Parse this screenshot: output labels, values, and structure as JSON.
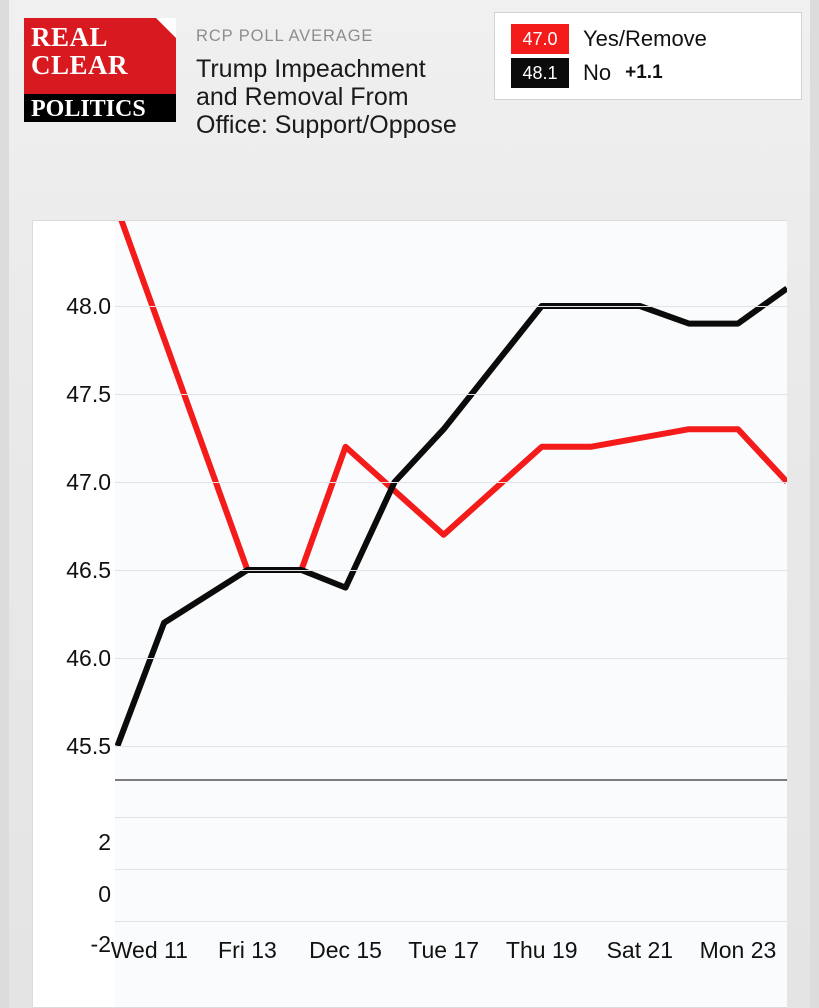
{
  "brand": {
    "line1": "REAL",
    "line2": "CLEAR",
    "line3": "POLITICS"
  },
  "header": {
    "kicker": "RCP POLL AVERAGE",
    "title": "Trump Impeachment and Removal From Office: Support/Oppose"
  },
  "legend": {
    "items": [
      {
        "value": "47.0",
        "label": "Yes/Remove",
        "delta": "",
        "color": "#f41b1b"
      },
      {
        "value": "48.1",
        "label": "No",
        "delta": "+1.1",
        "color": "#0b0b0b"
      }
    ]
  },
  "chart_data": {
    "type": "line",
    "title": "Trump Impeachment and Removal From Office: Support/Oppose",
    "subtitle": "RCP POLL AVERAGE",
    "xlabel": "",
    "ylabel": "",
    "grid": true,
    "legend_position": "top-right",
    "x_tick_labels": [
      "Wed 11",
      "Fri 13",
      "Dec 15",
      "Tue 17",
      "Thu 19",
      "Sat 21",
      "Mon 23"
    ],
    "x_tick_positions": [
      11,
      13,
      15,
      17,
      19,
      21,
      23
    ],
    "y_tick_labels": [
      "48.0",
      "47.5",
      "47.0",
      "46.5",
      "46.0",
      "45.5",
      "2",
      "0",
      "-2"
    ],
    "y_primary_ticks": [
      48.0,
      47.5,
      47.0,
      46.5,
      46.0,
      45.5
    ],
    "y_secondary_ticks": [
      2,
      0,
      -2
    ],
    "ylim": [
      45.3,
      48.5
    ],
    "xlim": [
      10.3,
      24.0
    ],
    "series": [
      {
        "name": "Yes/Remove",
        "color": "#f41b1b",
        "x": [
          10.35,
          13.0,
          14.1,
          15.0,
          17.0,
          19.0,
          20.0,
          22.0,
          23.0,
          24.0
        ],
        "values": [
          48.55,
          46.5,
          46.5,
          47.2,
          46.7,
          47.2,
          47.2,
          47.3,
          47.3,
          47.0
        ]
      },
      {
        "name": "No",
        "color": "#0b0b0b",
        "x": [
          10.35,
          11.3,
          13.0,
          14.1,
          15.0,
          16.0,
          17.0,
          19.0,
          21.0,
          22.0,
          23.0,
          24.0
        ],
        "values": [
          45.5,
          46.2,
          46.5,
          46.5,
          46.4,
          47.0,
          47.3,
          48.0,
          48.0,
          47.9,
          47.9,
          48.1
        ]
      }
    ],
    "current_values": {
      "Yes/Remove": 47.0,
      "No": 48.1,
      "spread": "+1.1"
    }
  }
}
